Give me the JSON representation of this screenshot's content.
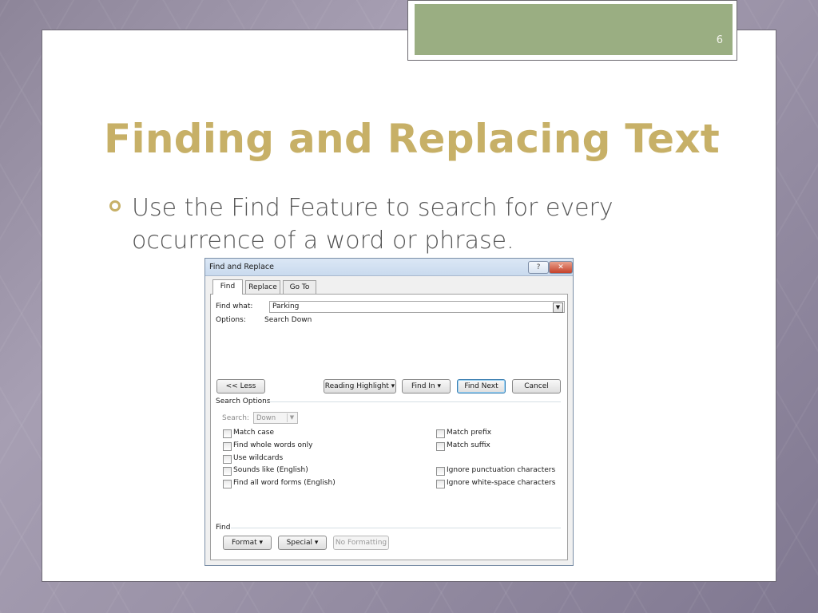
{
  "slide": {
    "number": "6",
    "title": "Finding and Replacing Text",
    "bullet": "Use the Find Feature to search for every occurrence of a word or phrase."
  },
  "colors": {
    "title": "#c7b067",
    "accent_box": "#9aae82",
    "bullet_text": "#555555"
  },
  "dialog": {
    "title": "Find and Replace",
    "help_button": "?",
    "close_button": "✕",
    "tabs": [
      "Find",
      "Replace",
      "Go To"
    ],
    "active_tab": "Find",
    "find_what_label": "Find what:",
    "find_what_value": "Parking",
    "options_label": "Options:",
    "options_value": "Search Down",
    "buttons": {
      "less": "<< Less",
      "reading_highlight": "Reading Highlight ▾",
      "find_in": "Find In ▾",
      "find_next": "Find Next",
      "cancel": "Cancel"
    },
    "search_options_header": "Search Options",
    "search_label": "Search:",
    "search_value": "Down",
    "left_options": [
      "Match case",
      "Find whole words only",
      "Use wildcards",
      "Sounds like (English)",
      "Find all word forms (English)"
    ],
    "right_options": [
      "Match prefix",
      "Match suffix",
      "Ignore punctuation characters",
      "Ignore white-space characters"
    ],
    "find_section_header": "Find",
    "bottom_buttons": {
      "format": "Format ▾",
      "special": "Special ▾",
      "no_formatting": "No Formatting"
    }
  }
}
